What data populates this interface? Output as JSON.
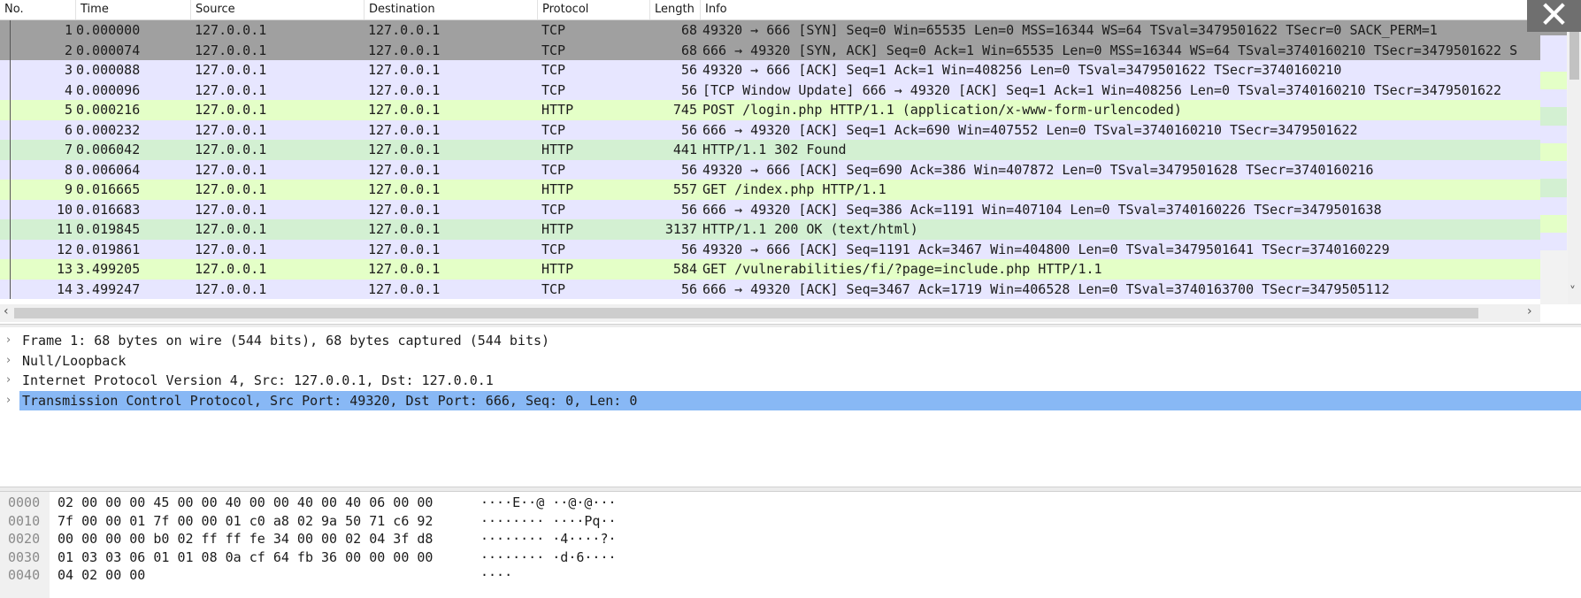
{
  "columns": [
    "No.",
    "Time",
    "Source",
    "Destination",
    "Protocol",
    "Length",
    "Info"
  ],
  "packets": [
    {
      "no": "1",
      "time": "0.000000",
      "src": "127.0.0.1",
      "dst": "127.0.0.1",
      "proto": "TCP",
      "len": "68",
      "info": "49320 → 666 [SYN] Seq=0 Win=65535 Len=0 MSS=16344 WS=64 TSval=3479501622 TSecr=0 SACK_PERM=1",
      "bg": "#a0a0a0"
    },
    {
      "no": "2",
      "time": "0.000074",
      "src": "127.0.0.1",
      "dst": "127.0.0.1",
      "proto": "TCP",
      "len": "68",
      "info": "666 → 49320 [SYN, ACK] Seq=0 Ack=1 Win=65535 Len=0 MSS=16344 WS=64 TSval=3740160210 TSecr=3479501622 S",
      "bg": "#a0a0a0"
    },
    {
      "no": "3",
      "time": "0.000088",
      "src": "127.0.0.1",
      "dst": "127.0.0.1",
      "proto": "TCP",
      "len": "56",
      "info": "49320 → 666 [ACK] Seq=1 Ack=1 Win=408256 Len=0 TSval=3479501622 TSecr=3740160210",
      "bg": "#e7e6ff"
    },
    {
      "no": "4",
      "time": "0.000096",
      "src": "127.0.0.1",
      "dst": "127.0.0.1",
      "proto": "TCP",
      "len": "56",
      "info": "[TCP Window Update] 666 → 49320 [ACK] Seq=1 Ack=1 Win=408256 Len=0 TSval=3740160210 TSecr=3479501622",
      "bg": "#e7e6ff"
    },
    {
      "no": "5",
      "time": "0.000216",
      "src": "127.0.0.1",
      "dst": "127.0.0.1",
      "proto": "HTTP",
      "len": "745",
      "info": "POST /login.php HTTP/1.1  (application/x-www-form-urlencoded)",
      "bg": "#e4ffc7"
    },
    {
      "no": "6",
      "time": "0.000232",
      "src": "127.0.0.1",
      "dst": "127.0.0.1",
      "proto": "TCP",
      "len": "56",
      "info": "666 → 49320 [ACK] Seq=1 Ack=690 Win=407552 Len=0 TSval=3740160210 TSecr=3479501622",
      "bg": "#e7e6ff"
    },
    {
      "no": "7",
      "time": "0.006042",
      "src": "127.0.0.1",
      "dst": "127.0.0.1",
      "proto": "HTTP",
      "len": "441",
      "info": "HTTP/1.1 302 Found",
      "bg": "#d3f0d2"
    },
    {
      "no": "8",
      "time": "0.006064",
      "src": "127.0.0.1",
      "dst": "127.0.0.1",
      "proto": "TCP",
      "len": "56",
      "info": "49320 → 666 [ACK] Seq=690 Ack=386 Win=407872 Len=0 TSval=3479501628 TSecr=3740160216",
      "bg": "#e7e6ff"
    },
    {
      "no": "9",
      "time": "0.016665",
      "src": "127.0.0.1",
      "dst": "127.0.0.1",
      "proto": "HTTP",
      "len": "557",
      "info": "GET /index.php HTTP/1.1",
      "bg": "#e4ffc7"
    },
    {
      "no": "10",
      "time": "0.016683",
      "src": "127.0.0.1",
      "dst": "127.0.0.1",
      "proto": "TCP",
      "len": "56",
      "info": "666 → 49320 [ACK] Seq=386 Ack=1191 Win=407104 Len=0 TSval=3740160226 TSecr=3479501638",
      "bg": "#e7e6ff"
    },
    {
      "no": "11",
      "time": "0.019845",
      "src": "127.0.0.1",
      "dst": "127.0.0.1",
      "proto": "HTTP",
      "len": "3137",
      "info": "HTTP/1.1 200 OK  (text/html)",
      "bg": "#d3f0d2"
    },
    {
      "no": "12",
      "time": "0.019861",
      "src": "127.0.0.1",
      "dst": "127.0.0.1",
      "proto": "TCP",
      "len": "56",
      "info": "49320 → 666 [ACK] Seq=1191 Ack=3467 Win=404800 Len=0 TSval=3479501641 TSecr=3740160229",
      "bg": "#e7e6ff"
    },
    {
      "no": "13",
      "time": "3.499205",
      "src": "127.0.0.1",
      "dst": "127.0.0.1",
      "proto": "HTTP",
      "len": "584",
      "info": "GET /vulnerabilities/fi/?page=include.php HTTP/1.1",
      "bg": "#e4ffc7"
    },
    {
      "no": "14",
      "time": "3.499247",
      "src": "127.0.0.1",
      "dst": "127.0.0.1",
      "proto": "TCP",
      "len": "56",
      "info": "666 → 49320 [ACK] Seq=3467 Ack=1719 Win=406528 Len=0 TSval=3740163700 TSecr=3479505112",
      "bg": "#e7e6ff"
    }
  ],
  "details": [
    {
      "text": "Frame 1: 68 bytes on wire (544 bits), 68 bytes captured (544 bits)",
      "selected": false
    },
    {
      "text": "Null/Loopback",
      "selected": false
    },
    {
      "text": "Internet Protocol Version 4, Src: 127.0.0.1, Dst: 127.0.0.1",
      "selected": false
    },
    {
      "text": "Transmission Control Protocol, Src Port: 49320, Dst Port: 666, Seq: 0, Len: 0",
      "selected": true
    }
  ],
  "hex": [
    {
      "offset": "0000",
      "bytes": "02 00 00 00 45 00 00 40  00 00 40 00 40 06 00 00",
      "ascii": "····E··@ ··@·@···"
    },
    {
      "offset": "0010",
      "bytes": "7f 00 00 01 7f 00 00 01  c0 a8 02 9a 50 71 c6 92",
      "ascii": "········ ····Pq··"
    },
    {
      "offset": "0020",
      "bytes": "00 00 00 00 b0 02 ff ff  fe 34 00 00 02 04 3f d8",
      "ascii": "········ ·4····?·"
    },
    {
      "offset": "0030",
      "bytes": "01 03 03 06 01 01 08 0a  cf 64 fb 36 00 00 00 00",
      "ascii": "········ ·d·6····"
    },
    {
      "offset": "0040",
      "bytes": "04 02 00 00",
      "ascii": "····"
    }
  ],
  "icons": {
    "close": "✕",
    "chevron_right": "›",
    "scroll_left": "‹",
    "scroll_right": "›",
    "scroll_up": "˄",
    "scroll_down": "˅"
  }
}
